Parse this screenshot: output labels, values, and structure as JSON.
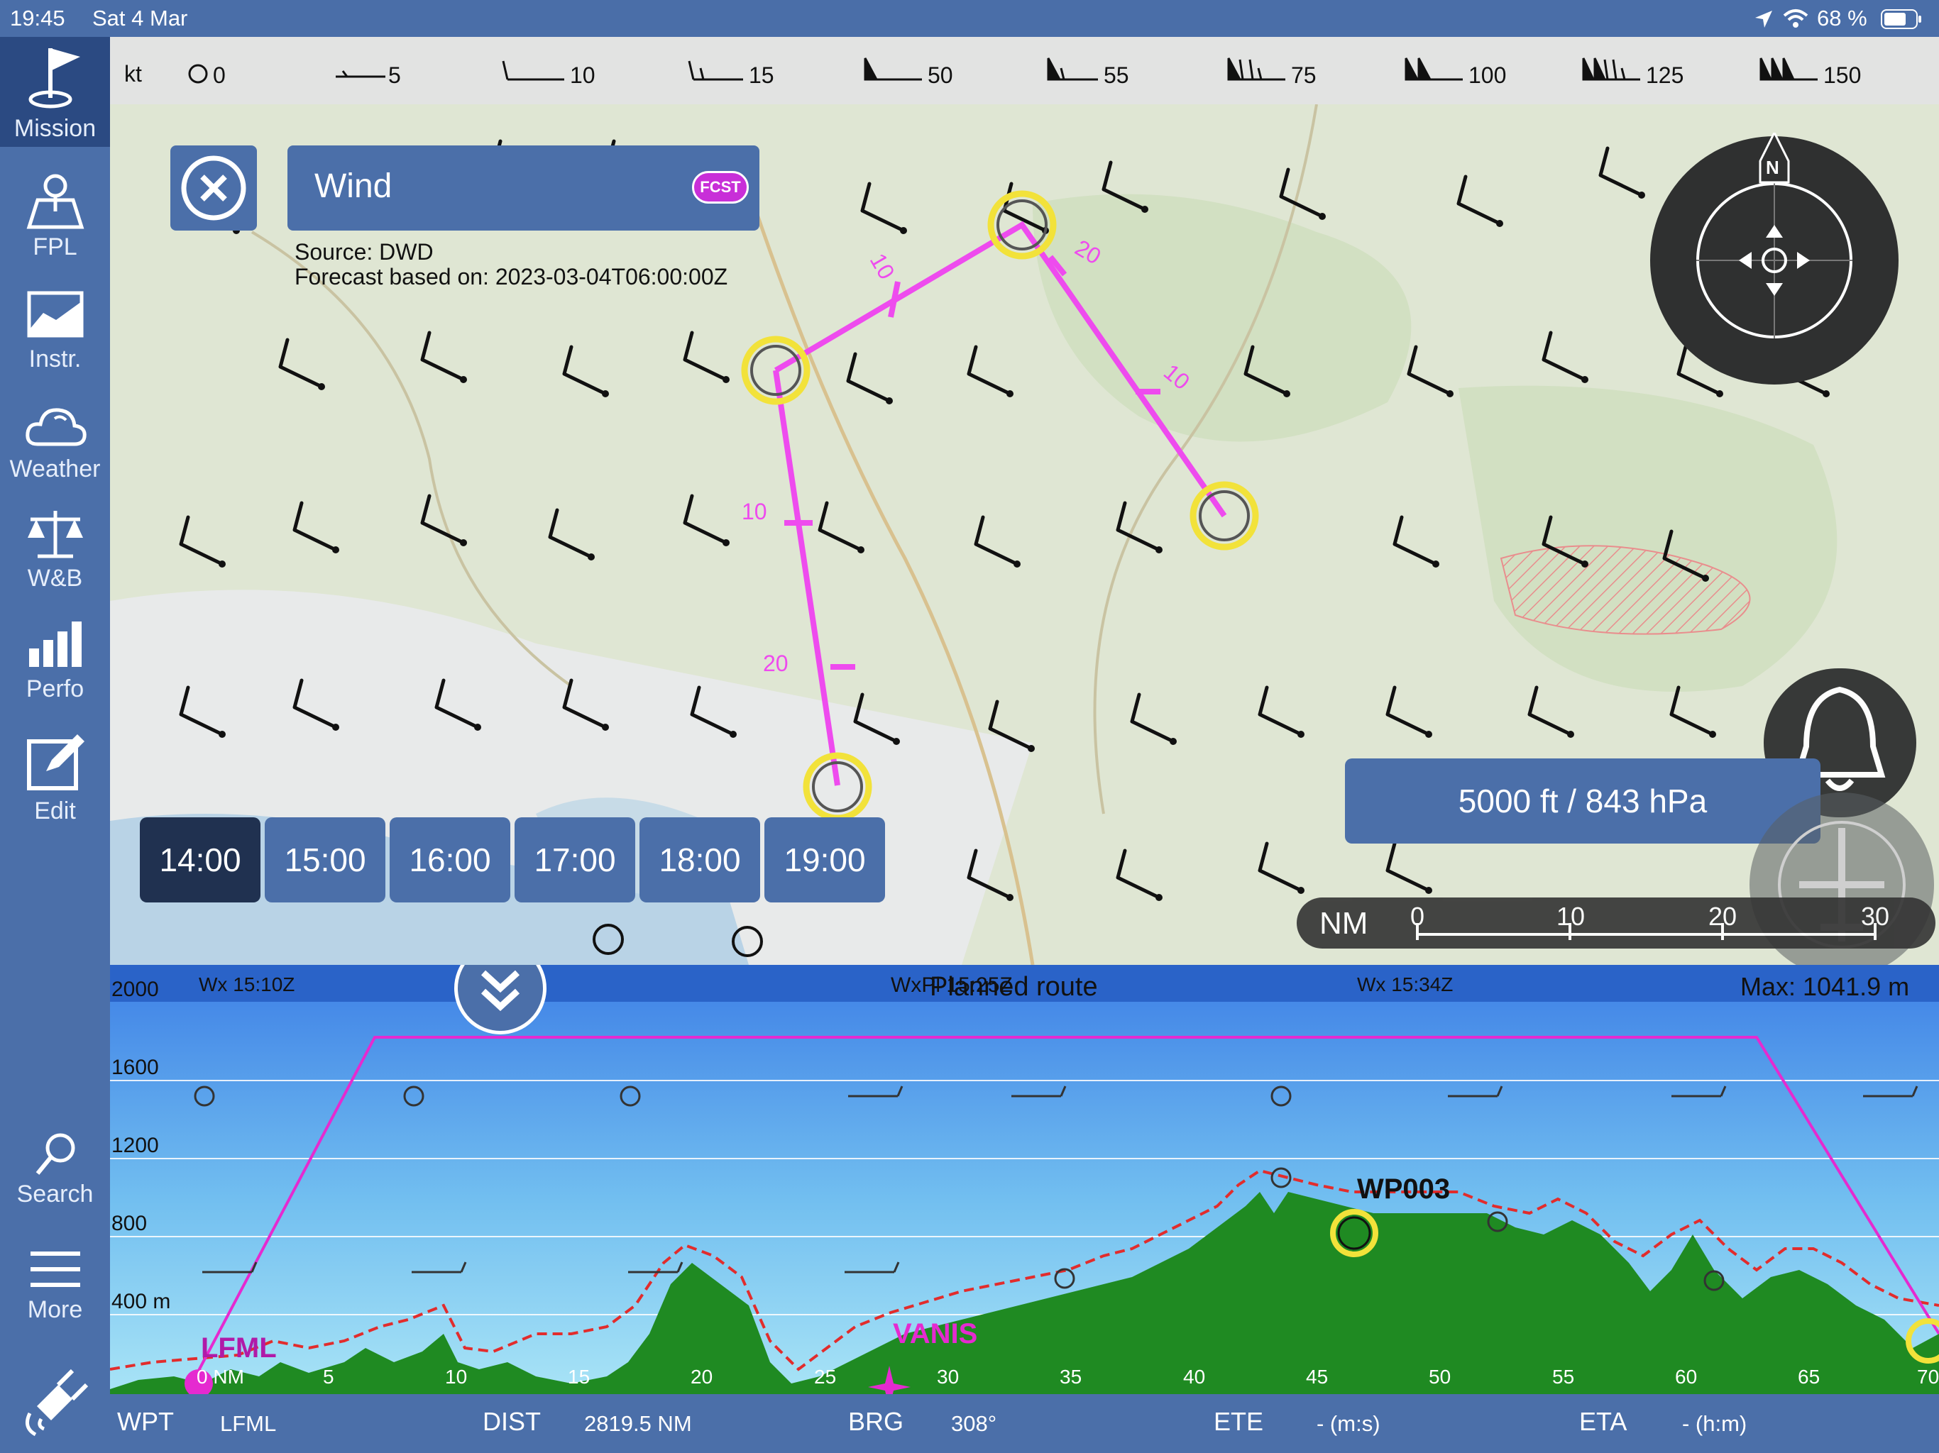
{
  "status": {
    "time": "19:45",
    "date": "Sat 4 Mar",
    "battery": "68 %"
  },
  "sidebar": {
    "items": [
      {
        "label": "Mission",
        "icon": "flag-icon"
      },
      {
        "label": "FPL",
        "icon": "map-pin-icon"
      },
      {
        "label": "Instr.",
        "icon": "chart-area-icon"
      },
      {
        "label": "Weather",
        "icon": "cloud-icon"
      },
      {
        "label": "W&B",
        "icon": "balance-icon"
      },
      {
        "label": "Perfo",
        "icon": "bar-chart-icon"
      },
      {
        "label": "Edit",
        "icon": "edit-icon"
      }
    ],
    "bottom": [
      {
        "label": "Search",
        "icon": "search-icon"
      },
      {
        "label": "More",
        "icon": "menu-icon"
      }
    ]
  },
  "wind_legend": {
    "unit": "kt",
    "entries": [
      "0",
      "5",
      "10",
      "15",
      "50",
      "55",
      "75",
      "100",
      "125",
      "150"
    ]
  },
  "wind_panel": {
    "title": "Wind",
    "badge": "FCST",
    "source": "Source: DWD",
    "forecast": "Forecast based on: 2023-03-04T06:00:00Z"
  },
  "route_labels": [
    "10",
    "20",
    "10",
    "20",
    "10"
  ],
  "level_label": "5000 ft / 843 hPa",
  "scale": {
    "unit": "NM",
    "ticks": [
      "0",
      "10",
      "20",
      "30"
    ]
  },
  "times": {
    "selected": "14:00",
    "options": [
      "14:00",
      "15:00",
      "16:00",
      "17:00",
      "18:00",
      "19:00"
    ]
  },
  "profile": {
    "title": "Planned route",
    "overlap_label": "WxPl 15:25Z",
    "wx_labels": [
      "Wx 15:10Z",
      "Wx 15:34Z"
    ],
    "max_label": "Max: 1041.9 m",
    "alt_labels": [
      "2000",
      "1600",
      "1200",
      "800",
      "400 m"
    ],
    "dist_labels": [
      "0 NM",
      "5",
      "10",
      "15",
      "20",
      "25",
      "30",
      "35",
      "40",
      "45",
      "50",
      "55",
      "60",
      "65",
      "70"
    ],
    "waypoints": [
      {
        "name": "LFML",
        "color": "#b01aa8"
      },
      {
        "name": "VANIS",
        "color": "#e52ad0"
      },
      {
        "name": "WP003",
        "color": "#111111"
      }
    ]
  },
  "bottom_bar": {
    "wpt_label": "WPT",
    "wpt_value": "LFML",
    "dist_label": "DIST",
    "dist_value": "2819.5 NM",
    "brg_label": "BRG",
    "brg_value": "308°",
    "ete_label": "ETE",
    "ete_value": "- (m:s)",
    "eta_label": "ETA",
    "eta_value": "- (h:m)"
  },
  "colors": {
    "sidebar": "#4b6fa9",
    "route": "#ee4bee",
    "waypoint": "#f2e23a",
    "terrain": "#1f8a22"
  }
}
